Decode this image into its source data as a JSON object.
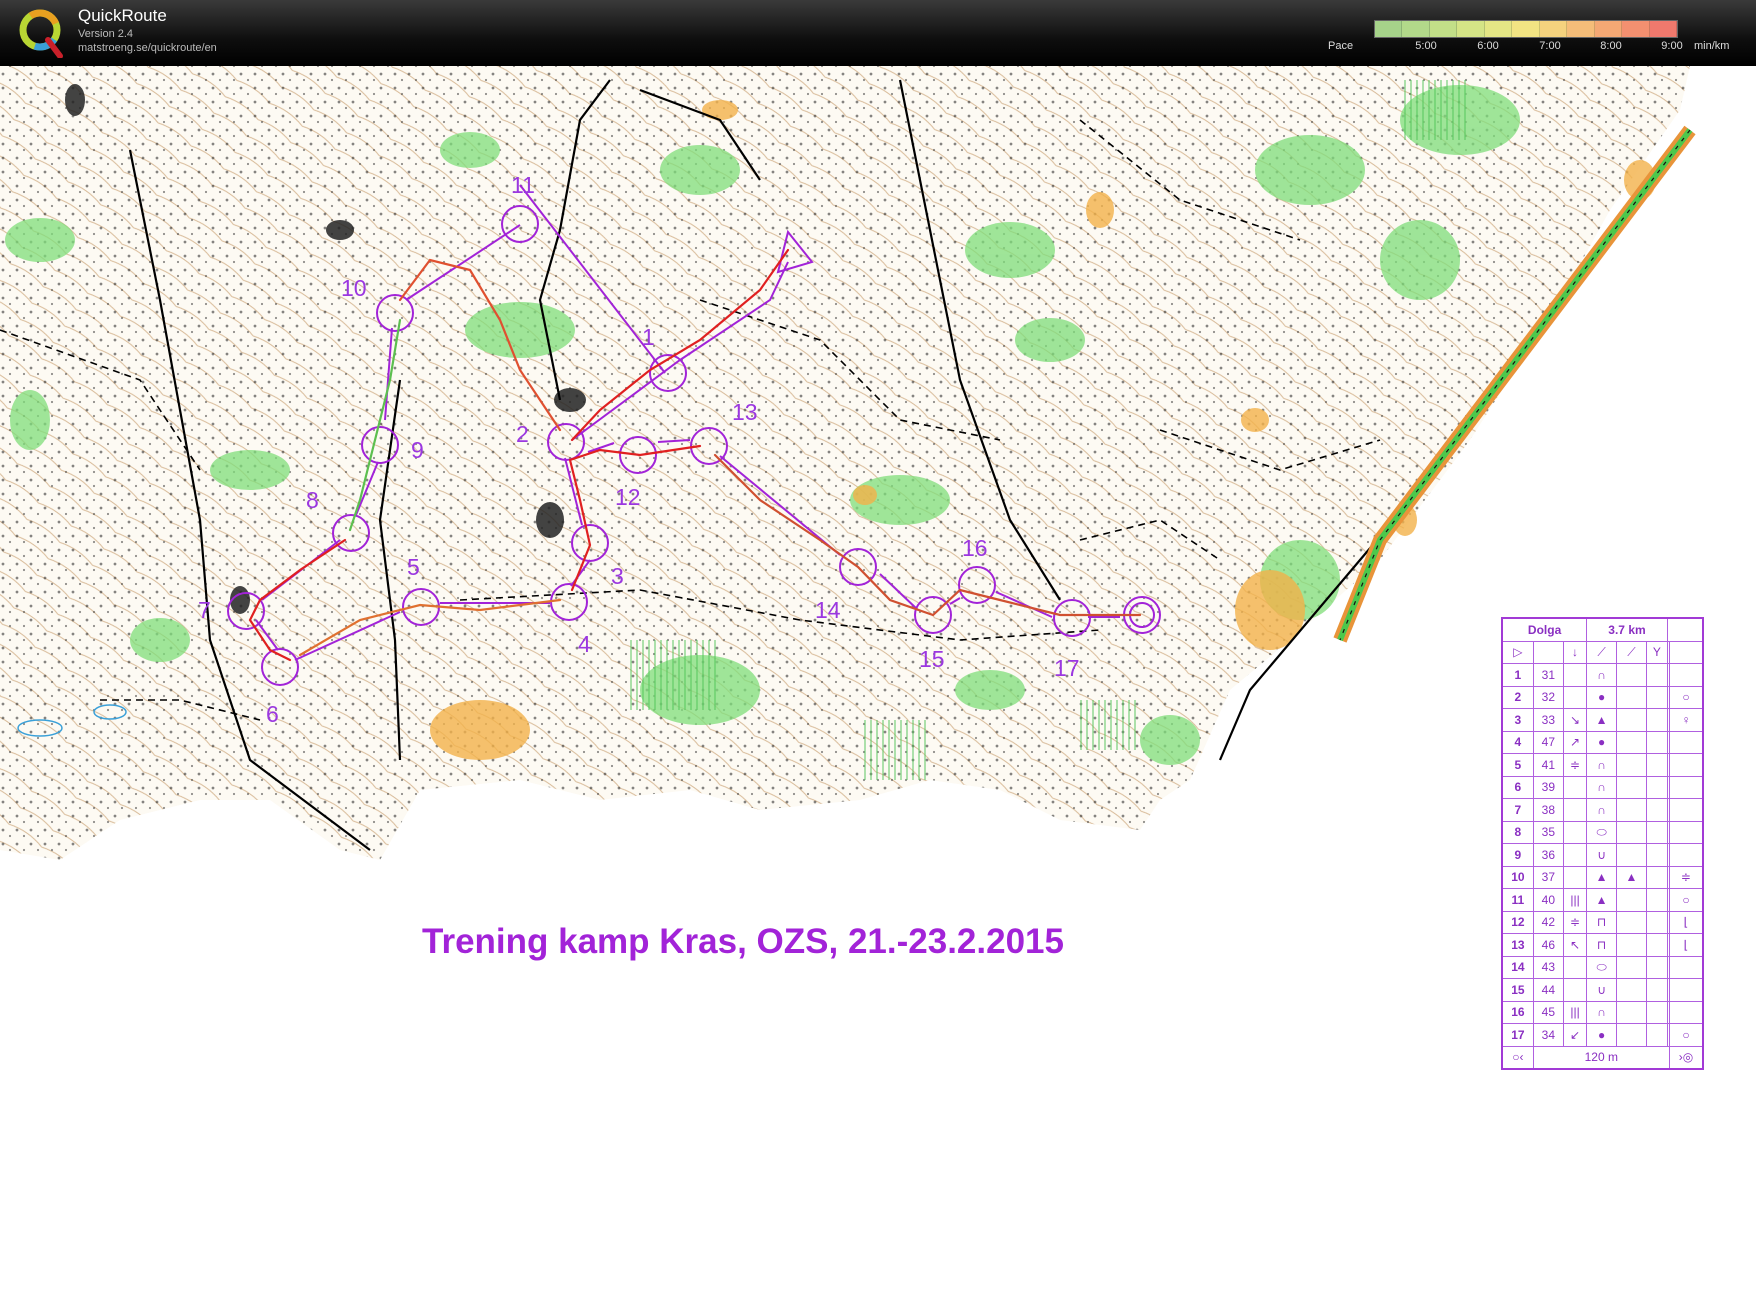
{
  "app": {
    "title": "QuickRoute",
    "version": "Version 2.4",
    "url": "matstroeng.se/quickroute/en"
  },
  "pace_legend": {
    "label": "Pace",
    "ticks": [
      "5:00",
      "6:00",
      "7:00",
      "8:00",
      "9:00"
    ],
    "unit": "min/km",
    "colors": [
      "#a6d38a",
      "#b2d98a",
      "#c2df88",
      "#d4e486",
      "#e4e685",
      "#f2e483",
      "#f5d27e",
      "#f5bd79",
      "#f4a874",
      "#f39070",
      "#f0796d"
    ]
  },
  "map": {
    "title": "Trening kamp Kras, OZS, 21.-23.2.2015",
    "course_color": "#a223d8",
    "route_color": "#e02020",
    "controls": [
      "1",
      "2",
      "3",
      "4",
      "5",
      "6",
      "7",
      "8",
      "9",
      "10",
      "11",
      "12",
      "13",
      "14",
      "15",
      "16",
      "17"
    ]
  },
  "control_card": {
    "course_name": "Dolga",
    "length": "3.7 km",
    "rows": [
      {
        "num": "1",
        "code": "31",
        "c": "",
        "d": "∩",
        "h": ""
      },
      {
        "num": "2",
        "code": "32",
        "c": "",
        "d": "●",
        "h": "○"
      },
      {
        "num": "3",
        "code": "33",
        "c": "↘",
        "d": "▲",
        "h": "♀"
      },
      {
        "num": "4",
        "code": "47",
        "c": "↗",
        "d": "●",
        "h": ""
      },
      {
        "num": "5",
        "code": "41",
        "c": "≑",
        "d": "∩",
        "h": ""
      },
      {
        "num": "6",
        "code": "39",
        "c": "",
        "d": "∩",
        "h": ""
      },
      {
        "num": "7",
        "code": "38",
        "c": "",
        "d": "∩",
        "h": ""
      },
      {
        "num": "8",
        "code": "35",
        "c": "",
        "d": "⬭",
        "h": ""
      },
      {
        "num": "9",
        "code": "36",
        "c": "",
        "d": "∪",
        "h": ""
      },
      {
        "num": "10",
        "code": "37",
        "c": "",
        "d": "▲",
        "e": "▲",
        "h": "≑"
      },
      {
        "num": "11",
        "code": "40",
        "c": "|||",
        "d": "▲",
        "h": "○"
      },
      {
        "num": "12",
        "code": "42",
        "c": "≑",
        "d": "⊓",
        "h": "⌊"
      },
      {
        "num": "13",
        "code": "46",
        "c": "↖",
        "d": "⊓",
        "h": "⌊"
      },
      {
        "num": "14",
        "code": "43",
        "c": "",
        "d": "⬭",
        "h": ""
      },
      {
        "num": "15",
        "code": "44",
        "c": "",
        "d": "∪",
        "h": ""
      },
      {
        "num": "16",
        "code": "45",
        "c": "|||",
        "d": "∩",
        "h": ""
      },
      {
        "num": "17",
        "code": "34",
        "c": "↙",
        "d": "●",
        "h": "○"
      }
    ],
    "finish_distance": "120 m"
  }
}
